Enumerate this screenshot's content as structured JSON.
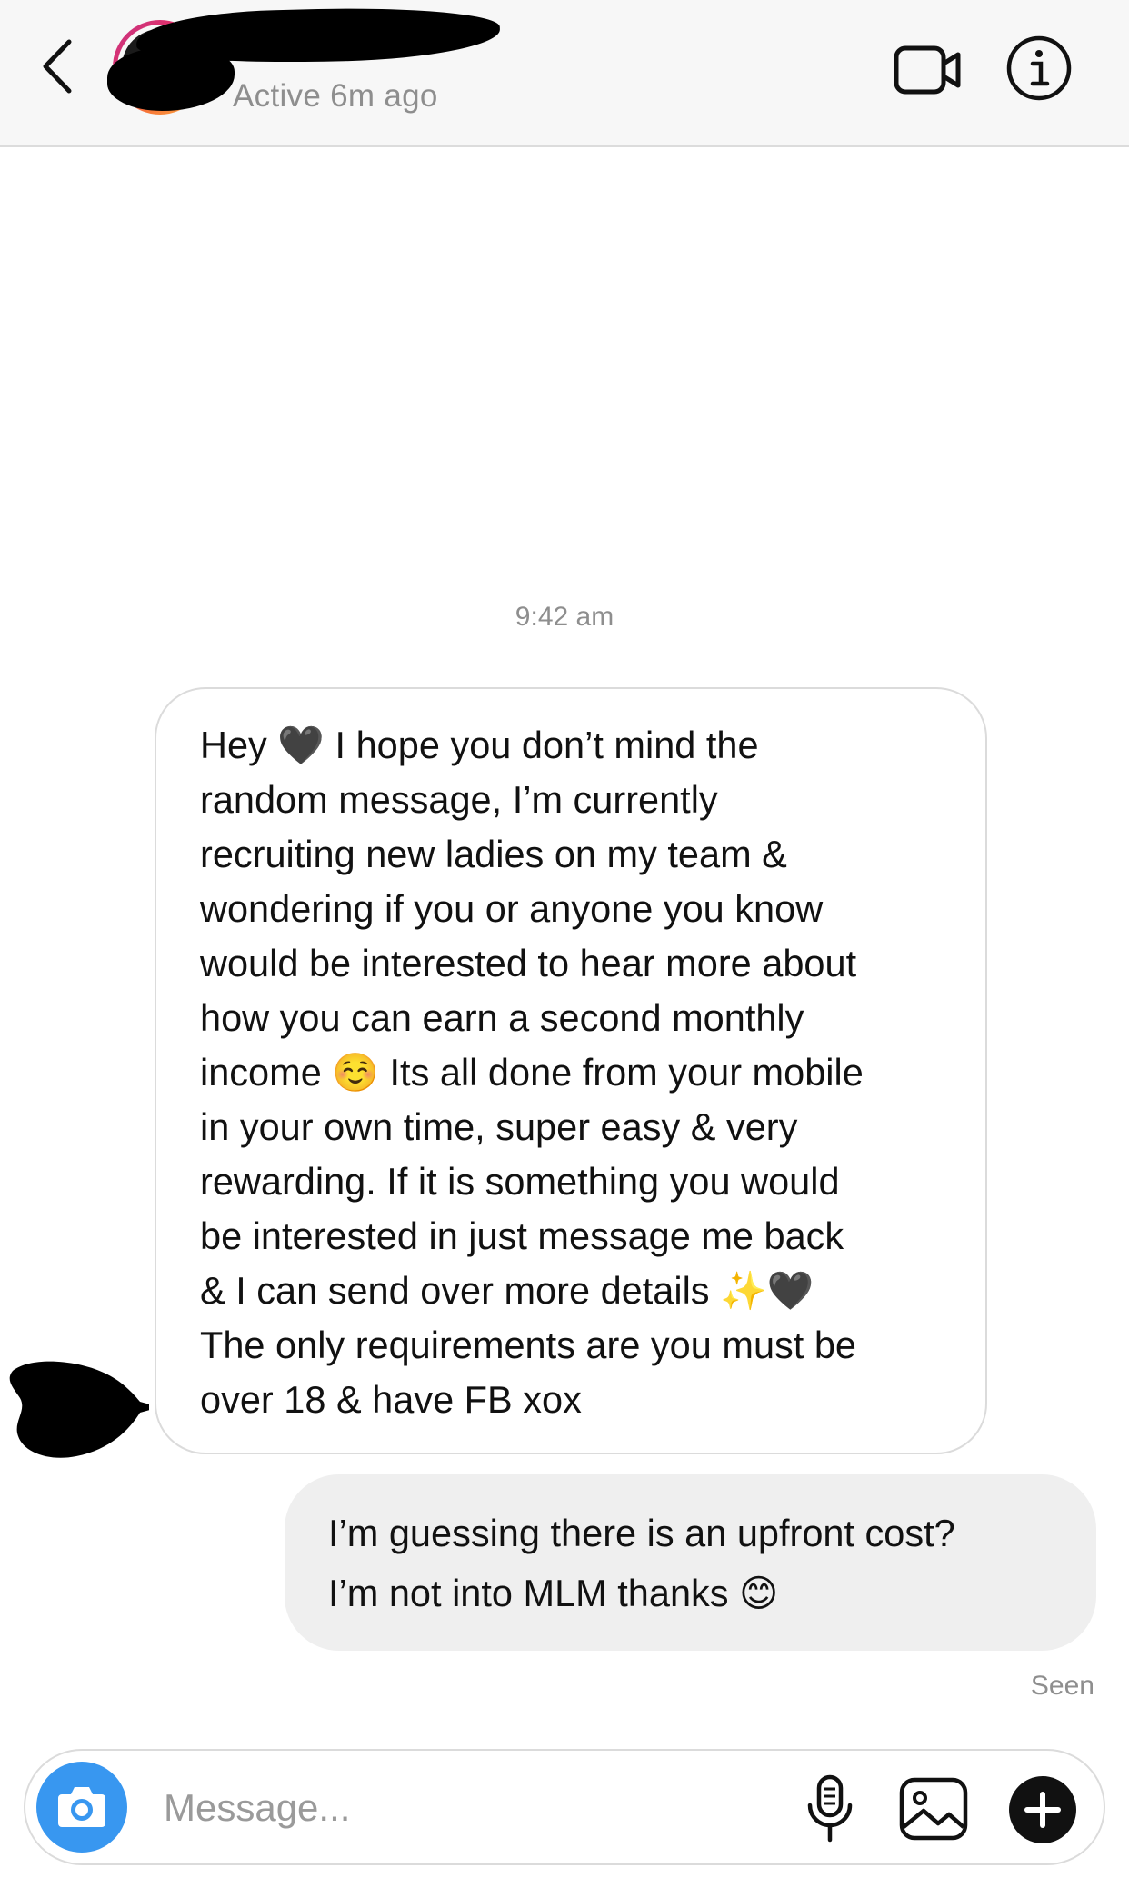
{
  "header": {
    "status_text": "Active 6m ago"
  },
  "conversation": {
    "timestamp": "9:42 am",
    "incoming": {
      "text": "Hey 🖤 I hope you don’t mind the\nrandom message, I’m currently\nrecruiting new ladies on my team &\nwondering if you or anyone you know\nwould be interested to hear more about\nhow you can earn a second monthly\nincome ☺️ Its all done from your mobile\nin your own time, super easy & very\nrewarding. If it is something you would\nbe interested in just message me back\n& I can send over more details ✨🖤\nThe only requirements are you must be\nover 18 & have FB xox"
    },
    "outgoing": {
      "text": "I’m guessing there is an upfront cost?\nI’m not into MLM thanks 😊"
    },
    "seen_label": "Seen"
  },
  "composer": {
    "placeholder": "Message..."
  },
  "icons": {
    "back": "chevron-left-icon",
    "video": "video-camera-icon",
    "info": "info-icon",
    "camera": "camera-icon",
    "mic": "microphone-icon",
    "gallery": "image-icon",
    "add": "plus-icon"
  },
  "colors": {
    "header_bg": "#f7f7f7",
    "outgoing_bubble": "#efefef",
    "incoming_border": "#dbdbdb",
    "camera_button": "#3897f0",
    "muted_text": "#8e8e8e"
  }
}
